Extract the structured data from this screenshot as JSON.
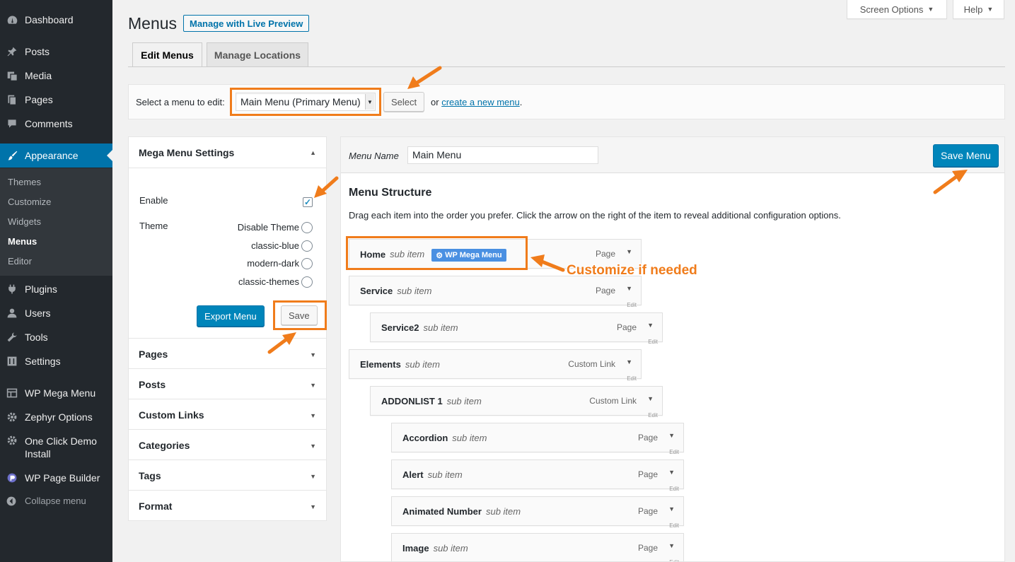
{
  "sidebar": {
    "items": {
      "dashboard": "Dashboard",
      "posts": "Posts",
      "media": "Media",
      "pages": "Pages",
      "comments": "Comments",
      "appearance": "Appearance",
      "plugins": "Plugins",
      "users": "Users",
      "tools": "Tools",
      "settings": "Settings",
      "wp_mega_menu": "WP Mega Menu",
      "zephyr": "Zephyr Options",
      "oneclick_1": "One Click Demo",
      "oneclick_2": "Install",
      "page_builder": "WP Page Builder",
      "collapse": "Collapse menu"
    },
    "submenu": {
      "themes": "Themes",
      "customize": "Customize",
      "widgets": "Widgets",
      "menus": "Menus",
      "editor": "Editor"
    }
  },
  "top": {
    "screen_options": "Screen Options",
    "help": "Help"
  },
  "header": {
    "title": "Menus",
    "live_preview": "Manage with Live Preview"
  },
  "tabs": {
    "edit": "Edit Menus",
    "locations": "Manage Locations"
  },
  "select_bar": {
    "label": "Select a menu to edit:",
    "selected": "Main Menu (Primary Menu)",
    "button": "Select",
    "or": "or",
    "create_link": "create a new menu",
    "period": "."
  },
  "mega": {
    "title": "Mega Menu Settings",
    "enable_label": "Enable",
    "enabled": true,
    "theme_label": "Theme",
    "themes": {
      "t0": "Disable Theme",
      "t1": "classic-blue",
      "t2": "modern-dark",
      "t3": "classic-themes"
    },
    "export_button": "Export Menu",
    "save_button": "Save"
  },
  "accordion": {
    "pages": "Pages",
    "posts": "Posts",
    "custom_links": "Custom Links",
    "categories": "Categories",
    "tags": "Tags",
    "format": "Format"
  },
  "main": {
    "menu_name_label": "Menu Name",
    "menu_name_value": "Main Menu",
    "save_menu": "Save Menu",
    "structure_title": "Menu Structure",
    "structure_desc": "Drag each item into the order you prefer. Click the arrow on the right of the item to reveal additional configuration options.",
    "sub_label": "sub item",
    "edit_label": "Edit",
    "badge": "WP Mega Menu",
    "items": {
      "i0": {
        "name": "Home",
        "type": "Page"
      },
      "i1": {
        "name": "Service",
        "type": "Page"
      },
      "i2": {
        "name": "Service2",
        "type": "Page"
      },
      "i3": {
        "name": "Elements",
        "type": "Custom Link"
      },
      "i4": {
        "name": "ADDONLIST 1",
        "type": "Custom Link"
      },
      "i5": {
        "name": "Accordion",
        "type": "Page"
      },
      "i6": {
        "name": "Alert",
        "type": "Page"
      },
      "i7": {
        "name": "Animated Number",
        "type": "Page"
      },
      "i8": {
        "name": "Image",
        "type": "Page"
      }
    }
  },
  "annotation": "Customize if needed",
  "colors": {
    "accent": "#0073aa",
    "highlight": "#f07c1b",
    "sidebar_bg": "#23282d"
  }
}
